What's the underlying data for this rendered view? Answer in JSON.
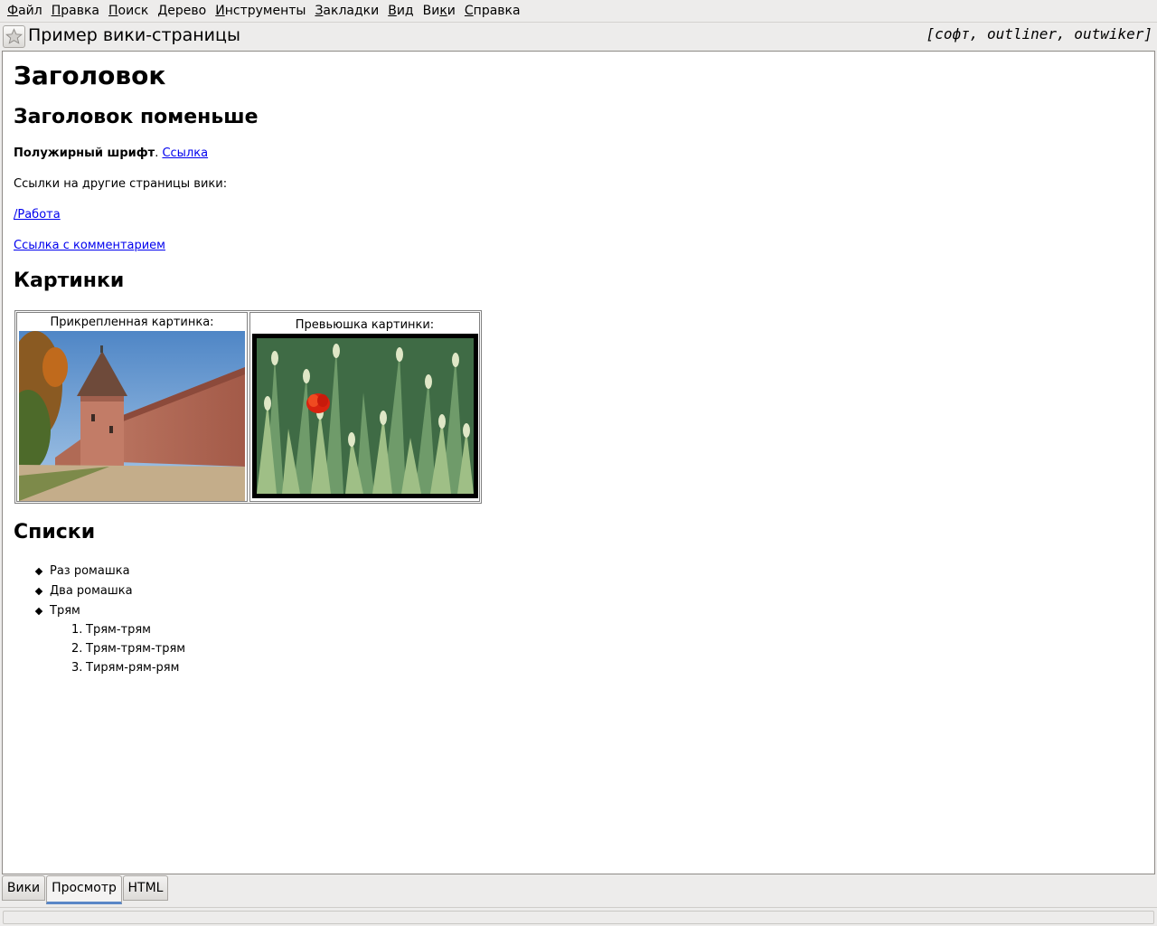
{
  "menu": [
    {
      "acc": "Ф",
      "rest": "айл"
    },
    {
      "acc": "П",
      "rest": "равка"
    },
    {
      "acc": "П",
      "rest": "оиск"
    },
    {
      "acc": "Д",
      "rest": "ерево"
    },
    {
      "acc": "И",
      "rest": "нструменты"
    },
    {
      "acc": "З",
      "rest": "акладки"
    },
    {
      "acc": "В",
      "rest": "ид"
    },
    {
      "pre": "Ви",
      "acc": "к",
      "rest": "и"
    },
    {
      "acc": "С",
      "rest": "правка"
    }
  ],
  "title_bar": {
    "title": "Пример вики-страницы",
    "tags": "[софт, outliner, outwiker]"
  },
  "content": {
    "h1": "Заголовок",
    "h2": "Заголовок поменьше",
    "bold_text": "Полужирный шрифт",
    "sep": ". ",
    "link": "Ссылка",
    "wiki_links_text": "Ссылки на другие страницы вики:",
    "page_link": "/Работа",
    "comment_link": "Ссылка с комментарием",
    "pictures_heading": "Картинки",
    "attached_caption": "Прикрепленная картинка:",
    "thumb_caption": "Превьюшка картинки:",
    "lists_heading": "Списки",
    "bullets": [
      "Раз ромашка",
      "Два ромашка",
      "Трям"
    ],
    "numbered": [
      {
        "n": "1.",
        "t": "Трям-трям"
      },
      {
        "n": "2.",
        "t": "Трям-трям-трям"
      },
      {
        "n": "3.",
        "t": "Тирям-рям-рям"
      }
    ]
  },
  "tabs": [
    "Вики",
    "Просмотр",
    "HTML"
  ],
  "active_tab": "Просмотр",
  "colors": {
    "link": "#0000ee",
    "tab_active_underline": "#5a87c7"
  },
  "icons": [
    "star-icon"
  ]
}
